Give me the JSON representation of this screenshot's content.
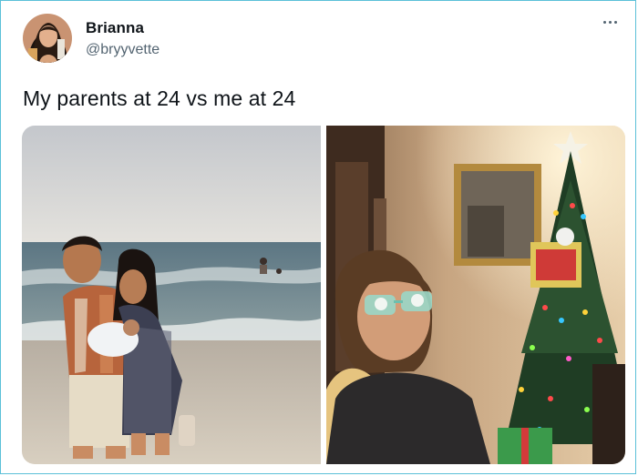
{
  "tweet": {
    "author_name": "Brianna",
    "author_handle": "@bryyvette",
    "text": "My parents at 24 vs me at 24"
  },
  "icons": {
    "more": "more-options-icon",
    "avatar": "avatar"
  },
  "colors": {
    "border_accent": "#5bc0d8",
    "handle": "#536471",
    "text": "#0f1419"
  }
}
